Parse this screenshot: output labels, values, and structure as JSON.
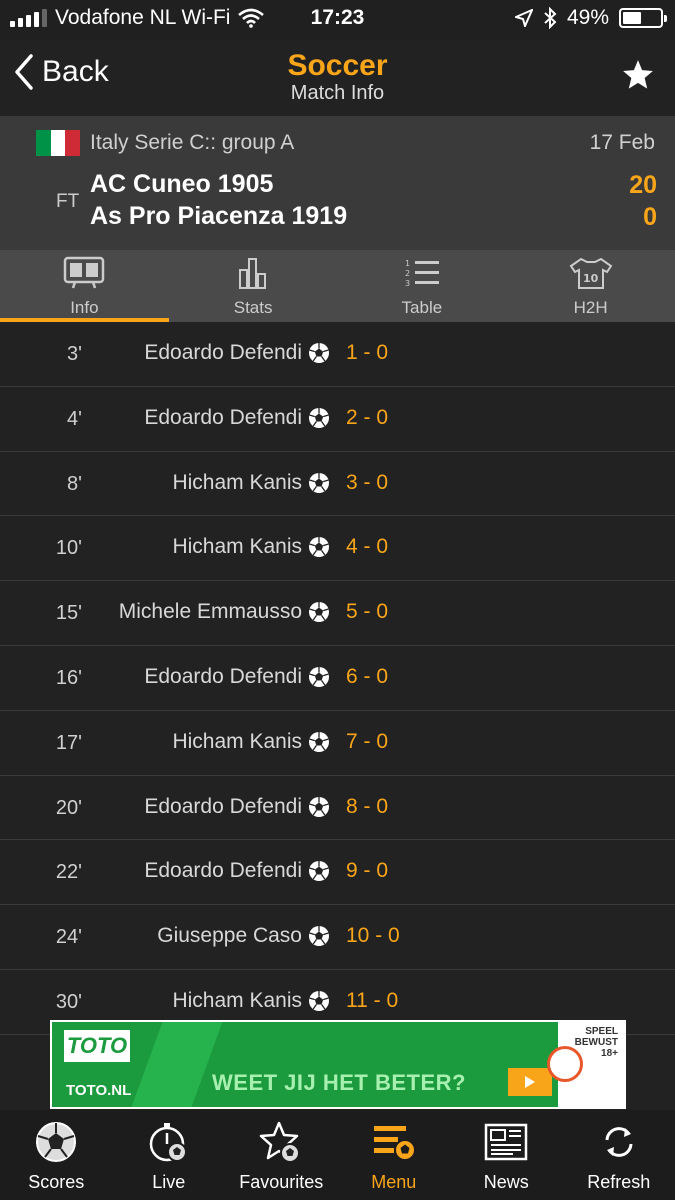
{
  "status_bar": {
    "carrier": "Vodafone NL Wi-Fi",
    "time": "17:23",
    "battery": "49%",
    "battery_level": 0.49
  },
  "nav": {
    "back_label": "Back",
    "title": "Soccer",
    "subtitle": "Match Info",
    "favourite_icon": "star-icon"
  },
  "match": {
    "flag": "italy-flag",
    "flag_colors": [
      "#009246",
      "#ffffff",
      "#ce2b37"
    ],
    "league": "Italy Serie C:: group A",
    "date": "17 Feb",
    "status": "FT",
    "home_team": "AC Cuneo 1905",
    "away_team": "As Pro Piacenza 1919",
    "home_score": "20",
    "away_score": "0"
  },
  "tabs": [
    {
      "label": "Info",
      "icon": "scoreboard-icon",
      "active": true
    },
    {
      "label": "Stats",
      "icon": "bar-chart-icon",
      "active": false
    },
    {
      "label": "Table",
      "icon": "list-icon",
      "active": false
    },
    {
      "label": "H2H",
      "icon": "jersey-icon",
      "active": false
    }
  ],
  "events": [
    {
      "minute": "3'",
      "player": "Edoardo Defendi",
      "score": "1 - 0"
    },
    {
      "minute": "4'",
      "player": "Edoardo Defendi",
      "score": "2 - 0"
    },
    {
      "minute": "8'",
      "player": "Hicham Kanis",
      "score": "3 - 0"
    },
    {
      "minute": "10'",
      "player": "Hicham Kanis",
      "score": "4 - 0"
    },
    {
      "minute": "15'",
      "player": "Michele Emmausso",
      "score": "5 - 0"
    },
    {
      "minute": "16'",
      "player": "Edoardo Defendi",
      "score": "6 - 0"
    },
    {
      "minute": "17'",
      "player": "Hicham Kanis",
      "score": "7 - 0"
    },
    {
      "minute": "20'",
      "player": "Edoardo Defendi",
      "score": "8 - 0"
    },
    {
      "minute": "22'",
      "player": "Edoardo Defendi",
      "score": "9 - 0"
    },
    {
      "minute": "24'",
      "player": "Giuseppe Caso",
      "score": "10 - 0"
    },
    {
      "minute": "30'",
      "player": "Hicham Kanis",
      "score": "11 - 0"
    }
  ],
  "ad": {
    "brand": "TOTO",
    "url": "TOTO.NL",
    "slogan": "WEET JIJ HET BETER?",
    "legal_line1": "SPEEL",
    "legal_line2": "BEWUST",
    "legal_line3": "18+"
  },
  "tabbar": [
    {
      "label": "Scores",
      "icon": "soccer-ball-icon",
      "active": false
    },
    {
      "label": "Live",
      "icon": "stopwatch-ball-icon",
      "active": false
    },
    {
      "label": "Favourites",
      "icon": "star-ball-icon",
      "active": false
    },
    {
      "label": "Menu",
      "icon": "menu-ball-icon",
      "active": true
    },
    {
      "label": "News",
      "icon": "newspaper-icon",
      "active": false
    },
    {
      "label": "Refresh",
      "icon": "refresh-icon",
      "active": false
    }
  ],
  "colors": {
    "accent": "#f9a51a",
    "background": "#222222",
    "header_bg": "#3a3a3a",
    "tab_bg": "#4a4a4a"
  }
}
